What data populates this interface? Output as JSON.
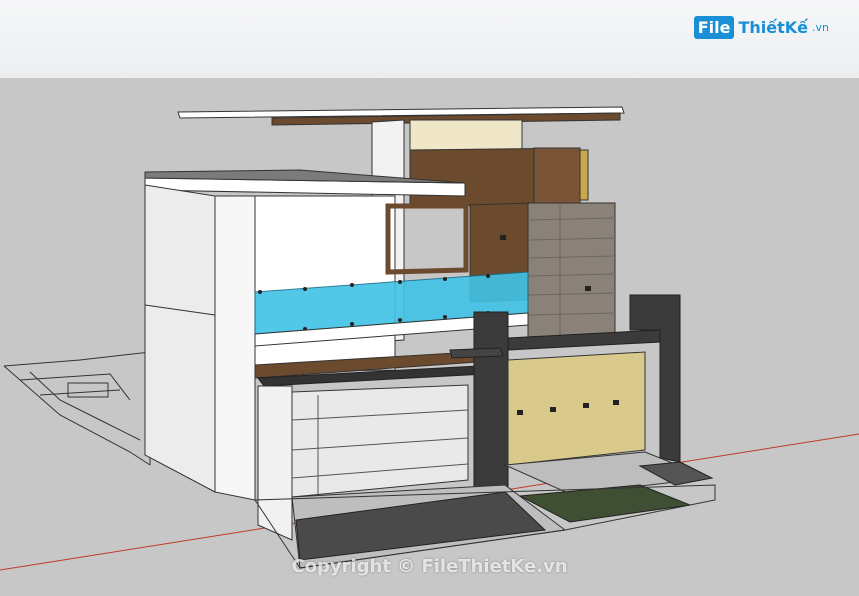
{
  "logo": {
    "mark": "File",
    "name": "ThiếtKế",
    "suffix": ".vn"
  },
  "watermark": "Copyright © FileThietKe.vn",
  "colors": {
    "sky": "#f2f3f5",
    "ground": "#c7c7c7",
    "glass": "#3fc3e6",
    "wood": "#6b4a2e",
    "stone": "#8a8278",
    "dark_wall": "#3b3b3b",
    "gate_panel": "#d9ca8c",
    "grass": "#3e4f34",
    "axis_red": "#c0392b",
    "logo_blue": "#1a8fd6"
  }
}
